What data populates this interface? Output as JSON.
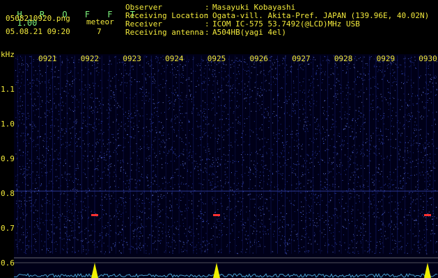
{
  "app": {
    "name": "HROFFT",
    "version": "1.00"
  },
  "file": {
    "name": "0508210920.png",
    "datetime": "05.08.21 09:20"
  },
  "meteor": {
    "label": "meteor",
    "count": "7"
  },
  "info": {
    "observer": {
      "label": "Observer",
      "sep": ":",
      "value": "Masayuki Kobayashi"
    },
    "location": {
      "label": "Receiving Location",
      "sep": ":",
      "value": "Ogata-vill. Akita-Pref. JAPAN (139.96E, 40.02N)"
    },
    "receiver": {
      "label": "Receiver",
      "sep": ":",
      "value": "ICOM IC-575 53.7492(@LCD)MHz USB"
    },
    "antenna": {
      "label": "Receiving antenna",
      "sep": ":",
      "value": "A504HB(yagi 4el)"
    }
  },
  "chart_data": {
    "type": "heatmap",
    "ylabel": "kHz",
    "y_ticks": [
      "1.1",
      "1.0",
      "0.9",
      "0.8",
      "0.7",
      "0.6"
    ],
    "x_ticks": [
      "0921",
      "0922",
      "0923",
      "0924",
      "0925",
      "0926",
      "0927",
      "0928",
      "0929",
      "0930"
    ],
    "meteor_echoes": [
      {
        "minute": "0922",
        "freq_khz": 0.75
      },
      {
        "minute": "0925",
        "freq_khz": 0.75
      },
      {
        "minute": "0930",
        "freq_khz": 0.75
      }
    ],
    "colors": {
      "background": "#000020",
      "noise": "#2a3aa8",
      "baseline": "#4aa0d0",
      "peak": "#f0f000",
      "echo": "#ff3030"
    }
  }
}
